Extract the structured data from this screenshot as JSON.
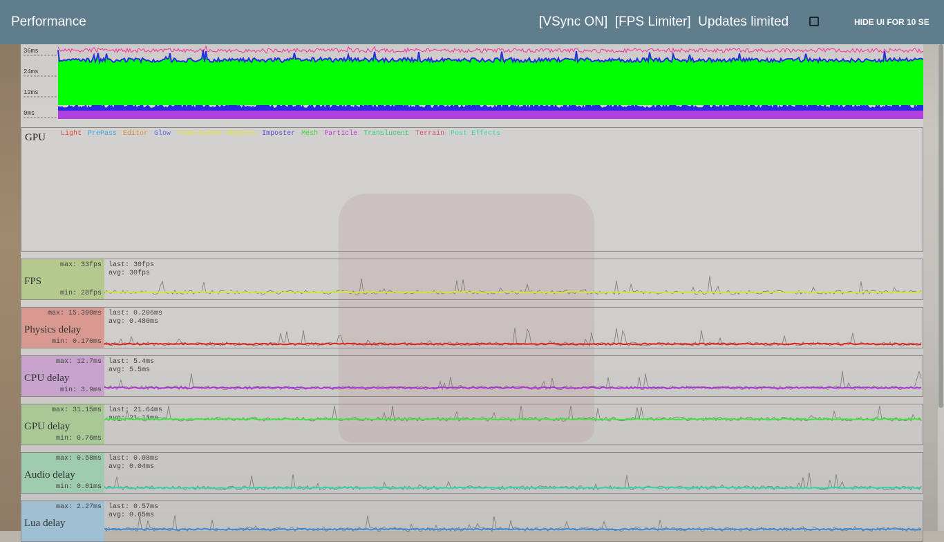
{
  "header": {
    "title": "Performance",
    "status": "[VSync ON]  [FPS Limiter]  Updates limited",
    "updates_limited_checked": false,
    "hide_ui_button": "HIDE UI FOR 10 SE"
  },
  "cpu_graph": {
    "y_ticks": [
      "36ms",
      "24ms",
      "12ms",
      "0ms"
    ]
  },
  "gpu_panel": {
    "title": "GPU",
    "legend": [
      {
        "name": "Light",
        "color": "#e8463c"
      },
      {
        "name": "PrePass",
        "color": "#3aa6e6"
      },
      {
        "name": "Editor",
        "color": "#e88c2c"
      },
      {
        "name": "Glow",
        "color": "#5870e0"
      },
      {
        "name": "Translucent Objects",
        "color": "#e6e62c"
      },
      {
        "name": "Imposter",
        "color": "#5a4ad8"
      },
      {
        "name": "Mesh",
        "color": "#3ad83a"
      },
      {
        "name": "Particle",
        "color": "#c03ad0"
      },
      {
        "name": "Translucent",
        "color": "#2cd06a"
      },
      {
        "name": "Terrain",
        "color": "#d84a6a"
      },
      {
        "name": "Post Effects",
        "color": "#3ad8b0"
      }
    ]
  },
  "metrics": [
    {
      "name": "FPS",
      "max": "max: 33fps",
      "min": "min: 28fps",
      "last": "last: 30fps",
      "avg": "avg: 30fps",
      "label_bg": "#b5c98e",
      "line_color": "#d6e53a",
      "level": 0.13
    },
    {
      "name": "Physics delay",
      "max": "max: 15.390ms",
      "min": "min: 0.170ms",
      "last": "last: 0.206ms",
      "avg": "avg: 0.480ms",
      "label_bg": "#d99890",
      "line_color": "#e02020",
      "level": 0.03
    },
    {
      "name": "CPU delay",
      "max": "max: 12.7ms",
      "min": "min: 3.9ms",
      "last": "last: 5.4ms",
      "avg": "avg: 5.5ms",
      "label_bg": "#c6a2cc",
      "line_color": "#b030d8",
      "level": 0.17
    },
    {
      "name": "GPU delay",
      "max": "max: 31.15ms",
      "min": "min: 0.76ms",
      "last": "last: 21.64ms",
      "avg": "avg: 21.11ms",
      "label_bg": "#a8c895",
      "line_color": "#3ae83a",
      "level": 0.68
    },
    {
      "name": "Audio delay",
      "max": "max: 0.58ms",
      "min": "min: 0.01ms",
      "last": "last: 0.08ms",
      "avg": "avg: 0.04ms",
      "label_bg": "#9ecaae",
      "line_color": "#2ad8a8",
      "level": 0.07
    },
    {
      "name": "Lua delay",
      "max": "max: 2.27ms",
      "min": "",
      "last": "last: 0.57ms",
      "avg": "avg: 0.65ms",
      "label_bg": "#9fbfd2",
      "line_color": "#3a8ad8",
      "level": 0.28
    }
  ]
}
